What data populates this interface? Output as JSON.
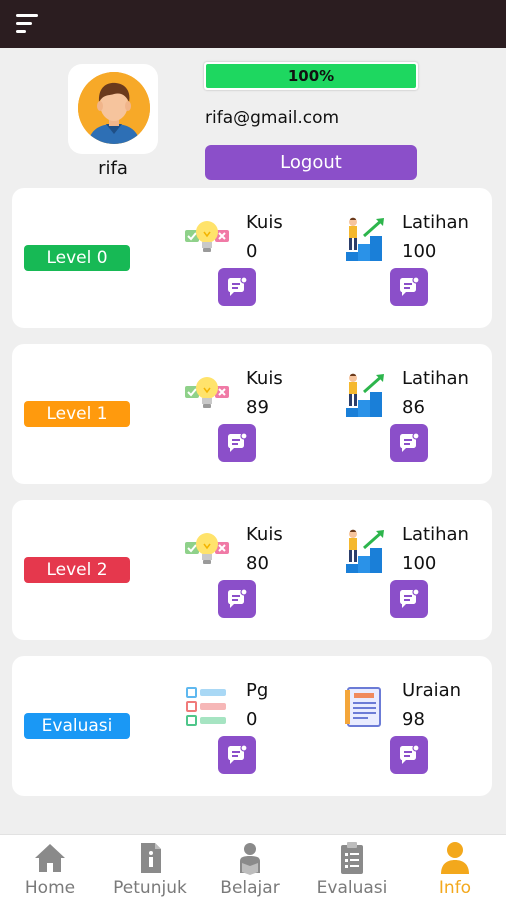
{
  "profile": {
    "username": "rifa",
    "email": "rifa@gmail.com",
    "progress_label": "100%",
    "progress_fraction": 1.0,
    "logout_label": "Logout"
  },
  "levels": [
    {
      "label": "Level 0",
      "color": "#17b955",
      "left": {
        "title": "Kuis",
        "value": "0",
        "icon": "quiz-icon"
      },
      "right": {
        "title": "Latihan",
        "value": "100",
        "icon": "exercise-icon"
      }
    },
    {
      "label": "Level 1",
      "color": "#ff9a0d",
      "left": {
        "title": "Kuis",
        "value": "89",
        "icon": "quiz-icon"
      },
      "right": {
        "title": "Latihan",
        "value": "86",
        "icon": "exercise-icon"
      }
    },
    {
      "label": "Level 2",
      "color": "#e5384d",
      "left": {
        "title": "Kuis",
        "value": "80",
        "icon": "quiz-icon"
      },
      "right": {
        "title": "Latihan",
        "value": "100",
        "icon": "exercise-icon"
      }
    },
    {
      "label": "Evaluasi",
      "color": "#1a98f5",
      "left": {
        "title": "Pg",
        "value": "0",
        "icon": "multiple-choice-icon"
      },
      "right": {
        "title": "Uraian",
        "value": "98",
        "icon": "essay-icon"
      }
    }
  ],
  "nav": [
    {
      "label": "Home",
      "icon": "home-icon"
    },
    {
      "label": "Petunjuk",
      "icon": "info-document-icon"
    },
    {
      "label": "Belajar",
      "icon": "reading-icon"
    },
    {
      "label": "Evaluasi",
      "icon": "clipboard-icon"
    },
    {
      "label": "Info",
      "icon": "user-icon",
      "active": true
    }
  ],
  "colors": {
    "accent_purple": "#8b4fc9",
    "progress_green": "#1ed760",
    "topbar": "#2b1d20",
    "nav_active": "#f3a81c",
    "nav_inactive": "#7a7a7a"
  }
}
